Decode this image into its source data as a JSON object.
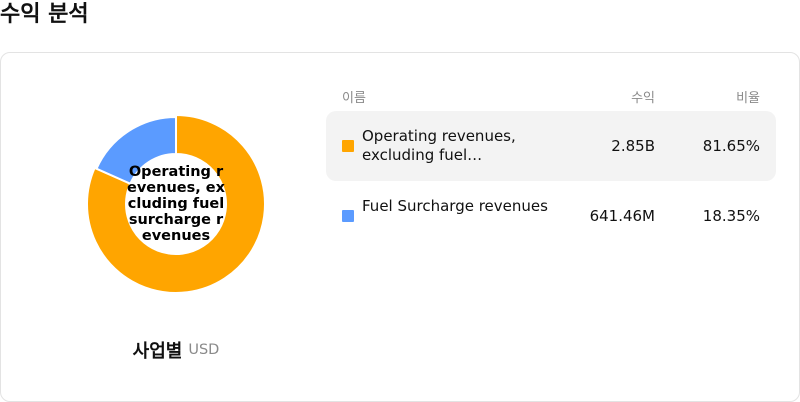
{
  "page_title": "수익 분석",
  "segment": {
    "title": "사업별",
    "currency": "USD"
  },
  "donut_center_label": "Operating revenues, excluding fuel surcharge revenues",
  "table": {
    "headers": {
      "name": "이름",
      "revenue": "수익",
      "ratio": "비율"
    },
    "rows": [
      {
        "name": "Operating revenues, excluding fuel…",
        "revenue": "2.85B",
        "ratio": "81.65%",
        "color": "#FFA500",
        "highlighted": true
      },
      {
        "name": "Fuel Surcharge revenues",
        "revenue": "641.46M",
        "ratio": "18.35%",
        "color": "#5B9BFF",
        "highlighted": false
      }
    ]
  },
  "chart_data": {
    "type": "pie",
    "donut": true,
    "categories": [
      "Operating revenues, excluding fuel surcharge revenues",
      "Fuel Surcharge revenues"
    ],
    "values": [
      81.65,
      18.35
    ],
    "unit": "%",
    "colors": [
      "#FFA500",
      "#5B9BFF"
    ],
    "start_angle": "top (12 o'clock), clockwise",
    "highlighted_slice": 0
  }
}
